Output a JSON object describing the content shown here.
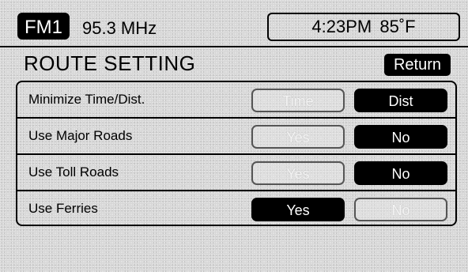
{
  "header": {
    "band": "FM1",
    "frequency": "95.3 MHz",
    "time": "4:23PM",
    "temperature": "85˚F"
  },
  "page": {
    "title": "ROUTE SETTING",
    "return_label": "Return"
  },
  "settings": [
    {
      "label": "Minimize Time/Dist.",
      "option_left": "Time",
      "option_right": "Dist",
      "selected": "Dist"
    },
    {
      "label": "Use Major Roads",
      "option_left": "Yes",
      "option_right": "No",
      "selected": "No"
    },
    {
      "label": "Use Toll Roads",
      "option_left": "Yes",
      "option_right": "No",
      "selected": "No"
    },
    {
      "label": "Use Ferries",
      "option_left": "Yes",
      "option_right": "No",
      "selected": "Yes"
    }
  ]
}
